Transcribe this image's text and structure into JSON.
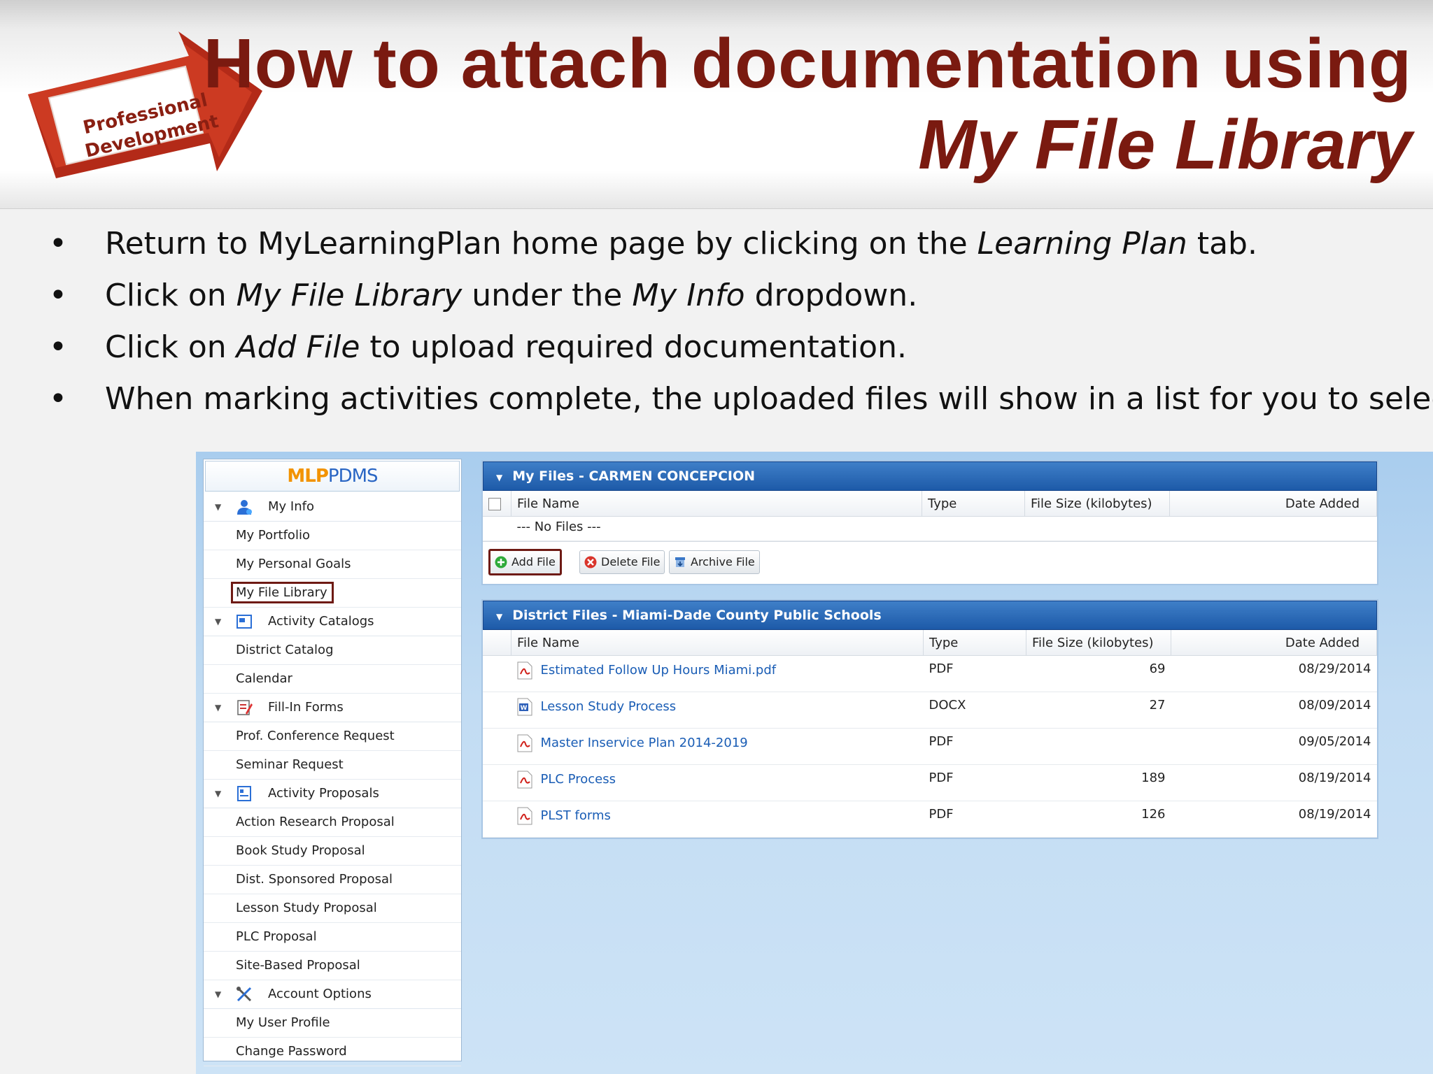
{
  "header": {
    "logo_text_line1": "Professional",
    "logo_text_line2": "Development",
    "title_line1": "How to attach documentation using",
    "title_line2": "My File Library"
  },
  "bullets": [
    {
      "a": "Return to MyLearningPlan home page by clicking on the ",
      "b": "Learning Plan",
      "c": " tab.",
      "d": "",
      "e": ""
    },
    {
      "a": "Click on ",
      "b": "My File Library",
      "c": " under the ",
      "d": "My Info",
      "e": " dropdown."
    },
    {
      "a": "Click on ",
      "b": "Add File",
      "c": " to upload required documentation.",
      "d": "",
      "e": ""
    },
    {
      "a": "When marking activities complete, the uploaded files will show in a list for you to select.",
      "b": "",
      "c": "",
      "d": "",
      "e": ""
    }
  ],
  "bullet_glyph": "•",
  "app": {
    "brand_mlp": "MLP",
    "brand_pdms": "PDMS",
    "nav": [
      {
        "group": "My Info",
        "icon": "user-icon",
        "items": [
          "My Portfolio",
          "My Personal Goals",
          "My File Library"
        ]
      },
      {
        "group": "Activity Catalogs",
        "icon": "catalog-icon",
        "items": [
          "District Catalog",
          "Calendar"
        ]
      },
      {
        "group": "Fill-In Forms",
        "icon": "form-icon",
        "items": [
          "Prof. Conference Request",
          "Seminar Request"
        ]
      },
      {
        "group": "Activity Proposals",
        "icon": "proposal-icon",
        "items": [
          "Action Research Proposal",
          "Book Study Proposal",
          "Dist. Sponsored Proposal",
          "Lesson Study Proposal",
          "PLC Proposal",
          "Site-Based Proposal"
        ]
      },
      {
        "group": "Account Options",
        "icon": "tools-icon",
        "items": [
          "My User Profile",
          "Change Password"
        ]
      }
    ],
    "my_files": {
      "title": "My Files - CARMEN CONCEPCION",
      "columns": [
        "File Name",
        "Type",
        "File Size (kilobytes)",
        "Date Added"
      ],
      "empty_text": "--- No Files ---",
      "buttons": {
        "add": "Add File",
        "delete": "Delete File",
        "archive": "Archive File"
      }
    },
    "district_files": {
      "title": "District Files - Miami-Dade County Public Schools",
      "columns": [
        "File Name",
        "Type",
        "File Size (kilobytes)",
        "Date Added"
      ],
      "rows": [
        {
          "name": "Estimated Follow Up Hours Miami.pdf",
          "type": "PDF",
          "size": "69",
          "date": "08/29/2014",
          "icon": "pdf-icon"
        },
        {
          "name": "Lesson Study Process",
          "type": "DOCX",
          "size": "27",
          "date": "08/09/2014",
          "icon": "word-icon"
        },
        {
          "name": "Master Inservice Plan 2014-2019",
          "type": "PDF",
          "size": "",
          "date": "09/05/2014",
          "icon": "pdf-icon"
        },
        {
          "name": "PLC Process",
          "type": "PDF",
          "size": "189",
          "date": "08/19/2014",
          "icon": "pdf-icon"
        },
        {
          "name": "PLST forms",
          "type": "PDF",
          "size": "126",
          "date": "08/19/2014",
          "icon": "pdf-icon"
        }
      ]
    }
  },
  "colors": {
    "title": "#7a1a10",
    "highlight_box": "#6e1a14",
    "panel_header": "#2a66b4",
    "link": "#1a5db5",
    "brand_mlp": "#f29300",
    "brand_pdms": "#2a66c4"
  }
}
